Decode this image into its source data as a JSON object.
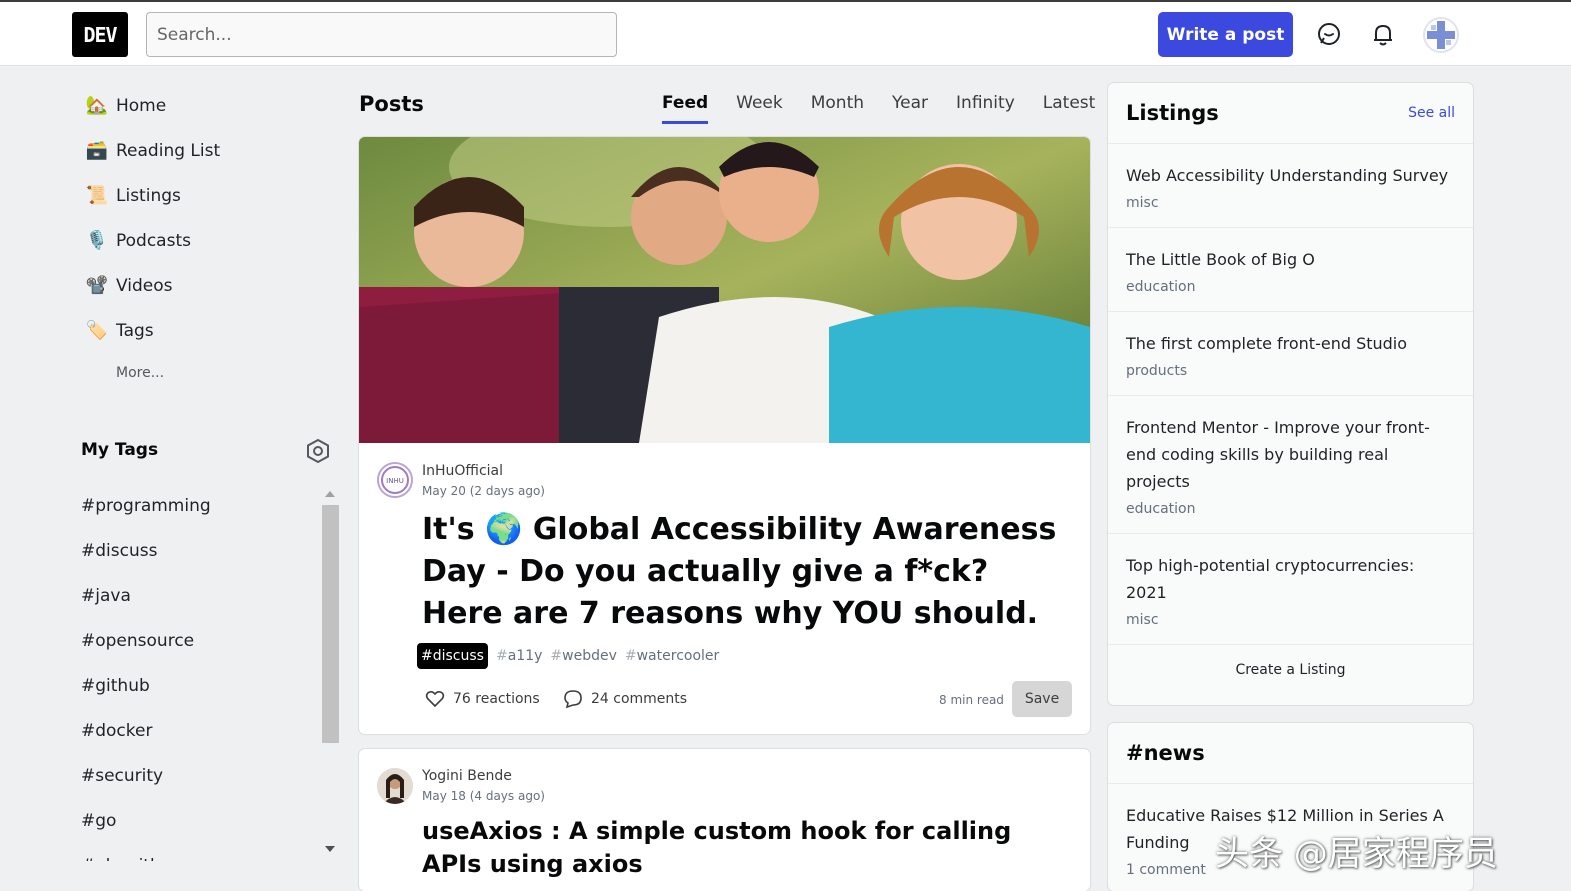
{
  "header": {
    "logo": "DEV",
    "search_placeholder": "Search...",
    "write_post": "Write a post"
  },
  "sidebar": {
    "items": [
      {
        "label": "Home",
        "icon": "🏡"
      },
      {
        "label": "Reading List",
        "icon": "🗃️"
      },
      {
        "label": "Listings",
        "icon": "📜"
      },
      {
        "label": "Podcasts",
        "icon": "🎙️"
      },
      {
        "label": "Videos",
        "icon": "📽️"
      },
      {
        "label": "Tags",
        "icon": "🏷️"
      }
    ],
    "more": "More...",
    "my_tags_title": "My Tags",
    "tags": [
      "#programming",
      "#discuss",
      "#java",
      "#opensource",
      "#github",
      "#docker",
      "#security",
      "#go",
      "#algorithms"
    ]
  },
  "main": {
    "posts_title": "Posts",
    "tabs": [
      "Feed",
      "Week",
      "Month",
      "Year",
      "Infinity",
      "Latest"
    ],
    "active_tab": "Feed",
    "post1": {
      "author": "InHuOfficial",
      "date": "May 20 (2 days ago)",
      "title_part1": "It's",
      "title_emoji": "🌍",
      "title_part2": "Global Accessibility Awareness Day - Do you actually give a f*ck? Here are 7 reasons why YOU should.",
      "tags": [
        "discuss",
        "a11y",
        "webdev",
        "watercooler"
      ],
      "reactions": "76 reactions",
      "comments": "24 comments",
      "read_time": "8 min read",
      "save": "Save"
    },
    "post2": {
      "author": "Yogini Bende",
      "date": "May 18 (4 days ago)",
      "title": "useAxios : A simple custom hook for calling APIs using axios"
    }
  },
  "listings": {
    "title": "Listings",
    "see_all": "See all",
    "items": [
      {
        "title": "Web Accessibility Understanding Survey",
        "category": "misc"
      },
      {
        "title": "The Little Book of Big O",
        "category": "education"
      },
      {
        "title": "The first complete front-end Studio",
        "category": "products"
      },
      {
        "title": "Frontend Mentor - Improve your front-end coding skills by building real projects",
        "category": "education"
      },
      {
        "title": "Top high-potential cryptocurrencies: 2021",
        "category": "misc"
      }
    ],
    "create": "Create a Listing"
  },
  "news": {
    "title": "#news",
    "items": [
      {
        "title": "Educative Raises $12 Million in Series A Funding",
        "meta": "1 comment"
      }
    ]
  },
  "watermark": "头条 @居家程序员",
  "colors": {
    "accent": "#3b49df",
    "background": "#eef0f1"
  }
}
